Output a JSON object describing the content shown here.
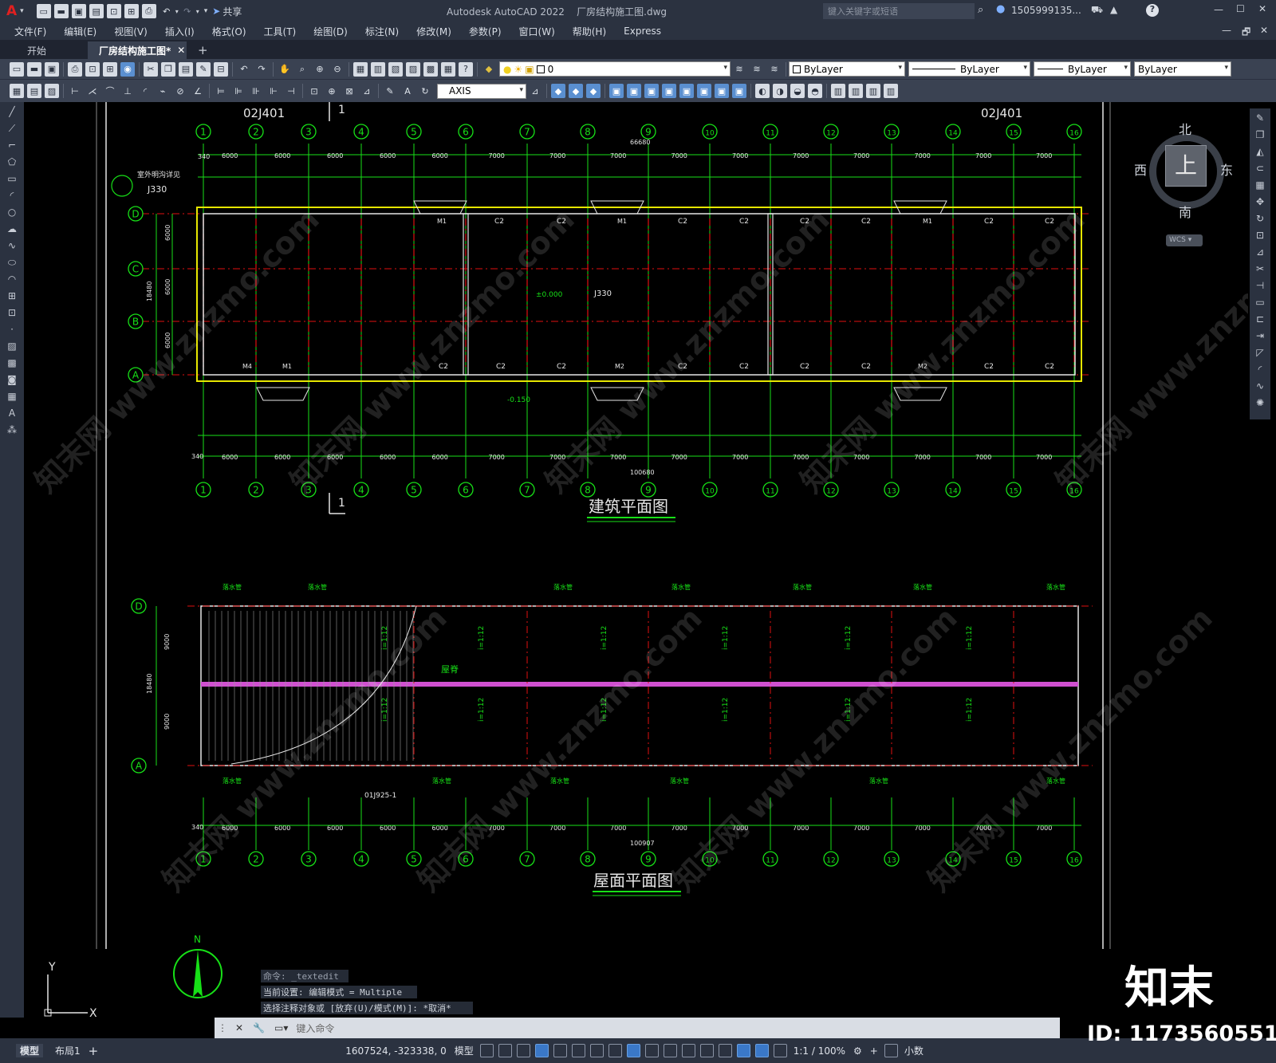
{
  "titlebar": {
    "app_logo": "A",
    "window_title": "Autodesk AutoCAD 2022    厂房结构施工图.dwg",
    "search_placeholder": "键入关键字或短语",
    "user": "1505999135...",
    "share": "共享",
    "controls": [
      "—",
      "☐",
      "✕"
    ]
  },
  "menubar": {
    "items": [
      "文件(F)",
      "编辑(E)",
      "视图(V)",
      "插入(I)",
      "格式(O)",
      "工具(T)",
      "绘图(D)",
      "标注(N)",
      "修改(M)",
      "参数(P)",
      "窗口(W)",
      "帮助(H)",
      "Express"
    ],
    "window_controls": [
      "—",
      "🗗",
      "✕"
    ]
  },
  "tabs": [
    {
      "label": "开始"
    },
    {
      "label": "厂房结构施工图*"
    }
  ],
  "toolbar": {
    "layer_value": "0",
    "color": "ByLayer",
    "linetype": "ByLayer",
    "lineweight": "ByLayer",
    "plotstyle": "ByLayer",
    "dimstyle": "AXIS"
  },
  "viewcube": {
    "north": "北",
    "south": "南",
    "east": "东",
    "west": "西",
    "top": "上",
    "wcs": "WCS"
  },
  "drawing": {
    "plan_title": "建筑平面图",
    "roof_title": "屋面平面图",
    "axis_numbers": [
      "1",
      "2",
      "3",
      "4",
      "5",
      "6",
      "7",
      "8",
      "9",
      "10",
      "11",
      "12",
      "13",
      "14",
      "15",
      "16"
    ],
    "axis_letters_plan": [
      "D",
      "C",
      "B",
      "A"
    ],
    "axis_letters_roof": [
      "D",
      "A"
    ],
    "spacings": [
      "6000",
      "6000",
      "6000",
      "6000",
      "6000",
      "7000",
      "7000",
      "7000",
      "7000",
      "7000",
      "7000",
      "7000",
      "7000",
      "7000",
      "7000"
    ],
    "plan_total_top": "66680",
    "plan_total_bottom": "100680",
    "roof_total": "100907",
    "plan_vertical": [
      "6000",
      "6000",
      "6000",
      "18480"
    ],
    "roof_vertical": [
      "9000",
      "9000",
      "18480"
    ],
    "detail_ref": "02J401",
    "detail_ref2": "J330",
    "section_mark": "1",
    "elevation": "±0.000",
    "elevation2": "-0.150",
    "slope": "i=1:12",
    "gutter": "落水管",
    "ridge": "屋脊",
    "door_labels": [
      "M1",
      "M2",
      "M3",
      "M4"
    ],
    "window_label": "C2",
    "edge_dim": "340",
    "note_ref": "01J925-1",
    "outdoor_note": "室外明沟详见"
  },
  "compass": {
    "label": "N"
  },
  "ucs": {
    "y": "Y",
    "x": "X"
  },
  "watermark": {
    "brand": "知末",
    "id": "ID: 1173560551",
    "site": "znzmo.com",
    "site_cn": "知末网 www.znzmo.com"
  },
  "command": {
    "history": [
      "命令: _textedit",
      "当前设置: 编辑模式 = Multiple",
      "选择注释对象或 [放弃(U)/模式(M)]: *取消*"
    ],
    "placeholder": "键入命令"
  },
  "status": {
    "tabs": [
      "模型",
      "布局1"
    ],
    "coords": "1607524, -323338, 0",
    "model": "模型",
    "scale": "1:1 / 100%",
    "units": "小数"
  },
  "colors": {
    "grid": "#17e017",
    "dashed": "#e01010",
    "wall": "#e6e6e6",
    "yellow": "#e6e600",
    "magenta": "#d050d0",
    "ui_bg": "#2b3240",
    "accent": "#3a78c8"
  }
}
